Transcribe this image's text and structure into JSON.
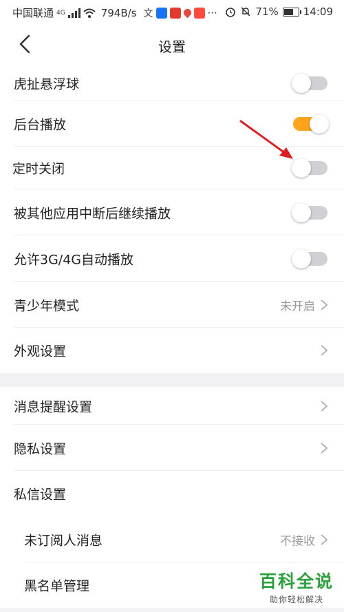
{
  "status_bar": {
    "carrier": "中国联通",
    "network": "4G",
    "speed": "794B/s",
    "battery": "71%",
    "battery_level": 0.71,
    "time": "14:09",
    "more": "···"
  },
  "nav": {
    "title": "设置"
  },
  "settings": {
    "float_ball": {
      "label": "虎扯悬浮球",
      "enabled": false
    },
    "background_play": {
      "label": "后台播放",
      "enabled": true
    },
    "timer_off": {
      "label": "定时关闭",
      "enabled": false
    },
    "resume_after_interrupt": {
      "label": "被其他应用中断后继续播放",
      "enabled": false
    },
    "allow_mobile_autoplay": {
      "label": "允许3G/4G自动播放",
      "enabled": false
    },
    "youth_mode": {
      "label": "青少年模式",
      "value": "未开启"
    },
    "appearance": {
      "label": "外观设置"
    },
    "notifications": {
      "label": "消息提醒设置"
    },
    "privacy": {
      "label": "隐私设置"
    },
    "private_messages": {
      "label": "私信设置"
    },
    "unsubscribed_messages": {
      "label": "未订阅人消息",
      "value": "不接收"
    },
    "blacklist": {
      "label": "黑名单管理"
    }
  },
  "watermark": {
    "main": "百科全说",
    "sub": "助你轻松解决"
  },
  "colors": {
    "accent_toggle_on": "#ffa41b",
    "toggle_off": "#d0d0d5",
    "annotation_arrow": "#e02020",
    "watermark_green": "#2aa13a"
  }
}
